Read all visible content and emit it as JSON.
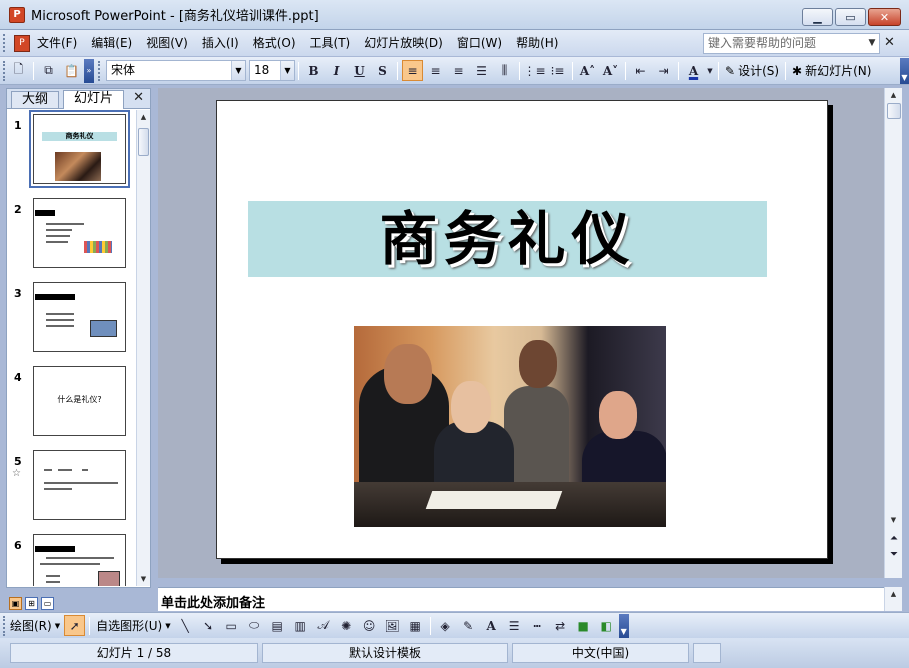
{
  "window": {
    "title": "Microsoft PowerPoint - [商务礼仪培训课件.ppt]",
    "app_icon_glyph": "P"
  },
  "menu": {
    "doc_icon_glyph": "P",
    "items": [
      "文件(F)",
      "编辑(E)",
      "视图(V)",
      "插入(I)",
      "格式(O)",
      "工具(T)",
      "幻灯片放映(D)",
      "窗口(W)",
      "帮助(H)"
    ],
    "help_placeholder": "键入需要帮助的问题"
  },
  "formatting": {
    "font": "宋体",
    "size": "18",
    "design_label": "设计(S)",
    "new_slide_label": "新幻灯片(N)"
  },
  "panel": {
    "tabs": [
      "大纲",
      "幻灯片"
    ],
    "active_tab": "幻灯片"
  },
  "thumbnails": [
    {
      "num": "1",
      "title": "商务礼仪"
    },
    {
      "num": "2"
    },
    {
      "num": "3"
    },
    {
      "num": "4",
      "text": "什么是礼仪?"
    },
    {
      "num": "5"
    },
    {
      "num": "6"
    }
  ],
  "slide": {
    "title": "商务礼仪",
    "title_bg": "#b8dfe3"
  },
  "notes": {
    "placeholder": "单击此处添加备注"
  },
  "drawing": {
    "draw_label": "绘图(R)",
    "autoshape_label": "自选图形(U)"
  },
  "status": {
    "slide_info": "幻灯片 1 / 58",
    "template": "默认设计模板",
    "language": "中文(中国)"
  },
  "colors": {
    "accent": "#f9c78b",
    "selection": "#4b6fb4"
  }
}
